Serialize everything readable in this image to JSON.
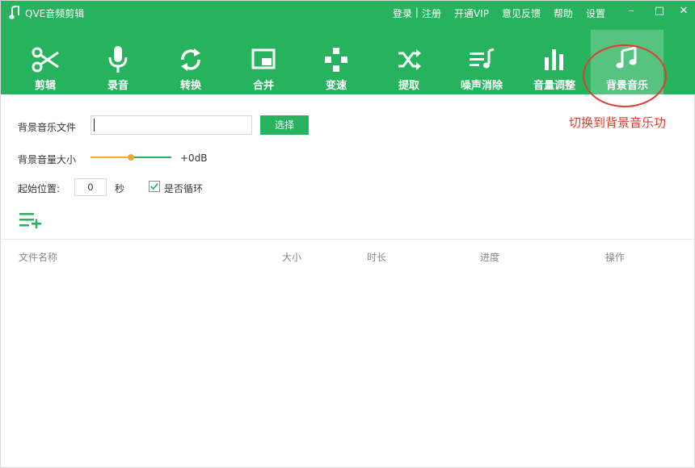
{
  "app": {
    "title": "QVE音频剪辑"
  },
  "header_links": {
    "login": "登录",
    "sep": "|",
    "register": "注册",
    "vip": "开通VIP",
    "feedback": "意见反馈",
    "help": "帮助",
    "settings": "设置"
  },
  "window_controls": {
    "minimize": "–",
    "maximize": "□",
    "close": "✕"
  },
  "toolbar": {
    "items": [
      {
        "label": "剪辑",
        "icon": "scissors-icon"
      },
      {
        "label": "录音",
        "icon": "microphone-icon"
      },
      {
        "label": "转换",
        "icon": "refresh-icon"
      },
      {
        "label": "合并",
        "icon": "merge-icon"
      },
      {
        "label": "变速",
        "icon": "speed-icon"
      },
      {
        "label": "提取",
        "icon": "shuffle-icon"
      },
      {
        "label": "噪声消除",
        "icon": "noise-removal-icon"
      },
      {
        "label": "音量调整",
        "icon": "volume-bars-icon"
      },
      {
        "label": "背景音乐",
        "icon": "music-note-icon",
        "active": true
      }
    ]
  },
  "annotation": "切换到背景音乐功",
  "form": {
    "bg_music_file_label": "背景音乐文件",
    "file_value": "",
    "choose_button": "选择",
    "volume_label": "背景音量大小",
    "volume_value": "+0dB",
    "volume_slider_fraction": 0.5,
    "start_label": "起始位置:",
    "start_value": "0",
    "seconds_unit": "秒",
    "loop_label": "是否循环",
    "loop_checked": true
  },
  "table": {
    "columns": [
      "文件名称",
      "大小",
      "时长",
      "进度",
      "操作"
    ]
  },
  "colors": {
    "brand_green": "#27b35d",
    "accent_orange": "#f3a833",
    "annotation_red": "#e03c31"
  }
}
